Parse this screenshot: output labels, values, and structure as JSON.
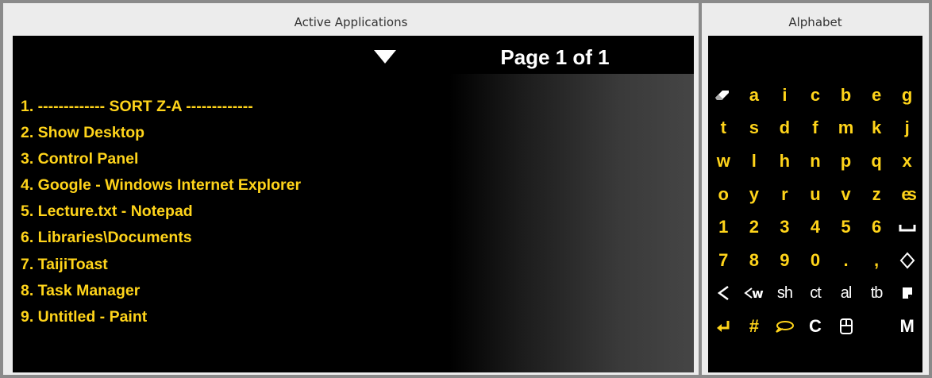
{
  "left_panel": {
    "title": "Active Applications",
    "page_label": "Page 1 of 1"
  },
  "apps": [
    "1. ------------- SORT Z-A -------------",
    "2. Show Desktop",
    "3. Control Panel",
    "4. Google - Windows Internet Explorer",
    "5. Lecture.txt - Notepad",
    "6. Libraries\\Documents",
    "7. TaijiToast",
    "8. Task Manager",
    "9. Untitled - Paint"
  ],
  "right_panel": {
    "title": "Alphabet"
  },
  "keys": {
    "row1": [
      "a",
      "i",
      "c",
      "b",
      "e",
      "g"
    ],
    "row2": [
      "t",
      "s",
      "d",
      "f",
      "m",
      "k",
      "j"
    ],
    "row3": [
      "w",
      "l",
      "h",
      "n",
      "p",
      "q",
      "x"
    ],
    "row4": [
      "o",
      "y",
      "r",
      "u",
      "v",
      "z"
    ],
    "row5": [
      "1",
      "2",
      "3",
      "4",
      "5",
      "6"
    ],
    "row6": [
      "7",
      "8",
      "9",
      "0",
      ".",
      ","
    ],
    "row7": [
      "sh",
      "ct",
      "al",
      "tb"
    ],
    "row8": [
      "#",
      "C",
      "M"
    ],
    "ligature": "es"
  },
  "colors": {
    "text_yellow": "#ffd41a",
    "background": "#000000",
    "frame": "#8a8a8a",
    "panel": "#ececec"
  },
  "icons": [
    "eraser-icon",
    "ligature-es-icon",
    "space-icon",
    "diamond-icon",
    "back-icon",
    "backword-icon",
    "note-icon",
    "enter-icon",
    "speech-bubble-icon",
    "mouse-icon"
  ]
}
